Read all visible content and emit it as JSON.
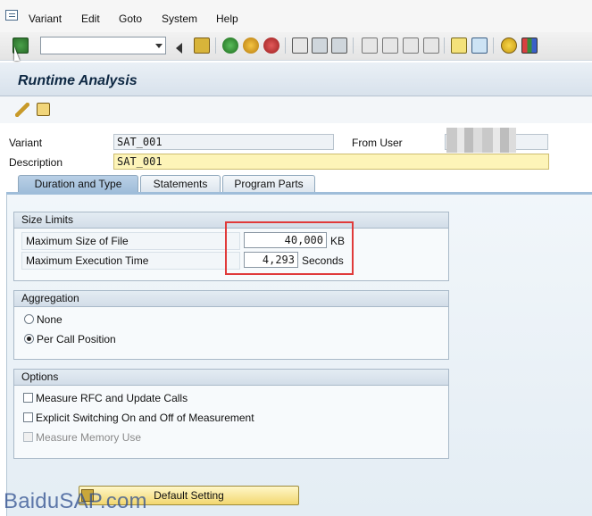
{
  "menu": {
    "items": [
      "Variant",
      "Edit",
      "Goto",
      "System",
      "Help"
    ]
  },
  "toolbar": {
    "command_field_value": "",
    "icons": [
      "check-icon",
      "back-icon",
      "save-icon",
      "green-back-icon",
      "exit-icon",
      "cancel-icon",
      "print-icon",
      "find-icon",
      "find-next-icon",
      "first-page-icon",
      "prev-page-icon",
      "next-page-icon",
      "last-page-icon",
      "new-session-icon",
      "shortcut-icon",
      "help-icon",
      "layout-icon"
    ]
  },
  "title": "Runtime Analysis",
  "app_toolbar": {
    "icons": [
      "edit-pencil-icon",
      "new-object-icon"
    ]
  },
  "header": {
    "variant_label": "Variant",
    "variant_value": "SAT_001",
    "from_user_label": "From User",
    "description_label": "Description",
    "description_value": "SAT_001"
  },
  "tabs": [
    {
      "label": "Duration and Type",
      "active": true
    },
    {
      "label": "Statements",
      "active": false
    },
    {
      "label": "Program Parts",
      "active": false
    }
  ],
  "size_limits": {
    "title": "Size Limits",
    "max_file_label": "Maximum Size of File",
    "max_file_value": "40,000",
    "max_file_unit": "KB",
    "max_time_label": "Maximum Execution Time",
    "max_time_value": "4,293",
    "max_time_unit": "Seconds"
  },
  "aggregation": {
    "title": "Aggregation",
    "options": [
      {
        "label": "None",
        "selected": false
      },
      {
        "label": "Per Call Position",
        "selected": true
      }
    ]
  },
  "options": {
    "title": "Options",
    "items": [
      {
        "label": "Measure RFC and Update Calls",
        "checked": false,
        "disabled": false
      },
      {
        "label": "Explicit Switching On and Off of Measurement",
        "checked": false,
        "disabled": false
      },
      {
        "label": "Measure Memory Use",
        "checked": false,
        "disabled": true
      }
    ]
  },
  "default_button": "Default Setting",
  "watermark": "BaiduSAP.com",
  "colors": {
    "highlight": "#e03a3a",
    "input_bg": "#fdf4b8",
    "title_text": "#0e2843"
  }
}
